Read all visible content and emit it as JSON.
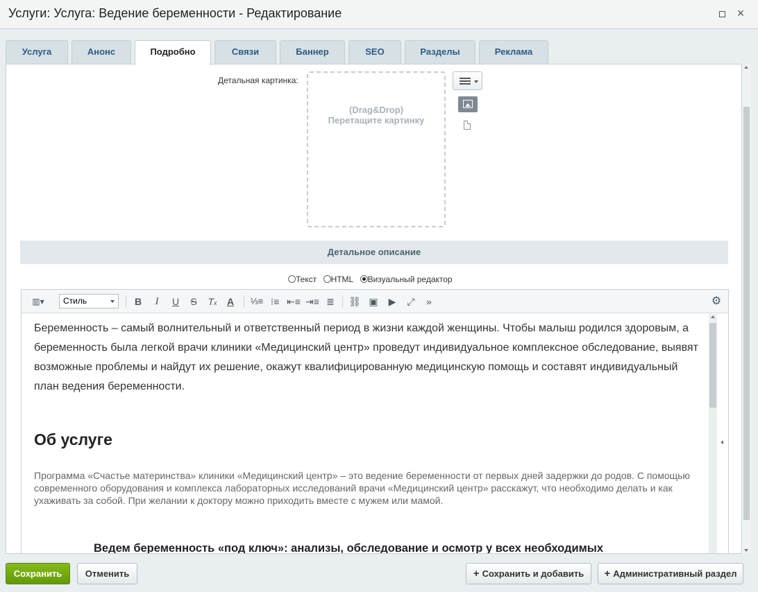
{
  "window": {
    "title": "Услуги: Услуга: Ведение беременности - Редактирование",
    "maximize_icon": "maximize-icon",
    "close_label": "×"
  },
  "tabs": [
    {
      "label": "Услуга",
      "active": false
    },
    {
      "label": "Анонс",
      "active": false
    },
    {
      "label": "Подробно",
      "active": true
    },
    {
      "label": "Связи",
      "active": false
    },
    {
      "label": "Баннер",
      "active": false
    },
    {
      "label": "SEO",
      "active": false
    },
    {
      "label": "Разделы",
      "active": false
    },
    {
      "label": "Реклама",
      "active": false
    }
  ],
  "detail_picture": {
    "label": "Детальная картинка:",
    "drop_line1": "(Drag&Drop)",
    "drop_line2": "Перетащите картинку",
    "icons": [
      "menu-icon",
      "image-icon",
      "file-icon"
    ]
  },
  "detail_description": {
    "header": "Детальное описание",
    "modes": [
      {
        "label": "Текст",
        "selected": false
      },
      {
        "label": "HTML",
        "selected": false
      },
      {
        "label": "Визуальный редактор",
        "selected": true
      }
    ]
  },
  "editor": {
    "style_select": "Стиль",
    "toolbar_icons": [
      "view-mode-icon",
      "bold-icon",
      "italic-icon",
      "underline-icon",
      "strikethrough-icon",
      "remove-format-icon",
      "font-color-icon",
      "ordered-list-icon",
      "unordered-list-icon",
      "outdent-icon",
      "indent-icon",
      "justify-icon",
      "link-icon",
      "image-icon",
      "video-icon",
      "fullscreen-icon",
      "more-icon",
      "settings-icon"
    ],
    "content": {
      "intro": "Беременность – самый волнительный и ответственный период в жизни каждой женщины. Чтобы малыш родился здоровым, а беременность была легкой врачи клиники «Медицинский центр» проведут индивидуальное комплексное обследование, выявят возможные проблемы и найдут их решение, окажут квалифицированную медицинскую помощь и составят индивидуальный план ведения беременности.",
      "heading": "Об услуге",
      "program": "Программа «Счастье материнства» клиники «Медицинский центр» – это ведение беременности от первых дней задержки до родов. С помощью современного оборудования и комплекса лабораторных исследований врачи «Медицинский центр» расскажут, что необходимо делать и как ухаживать за собой. При желании к доктору можно приходить вместе с мужем или мамой.",
      "subheading": "Ведем беременность «под ключ»: анализы, обследование и осмотр у всех необходимых"
    }
  },
  "footer": {
    "save": "Сохранить",
    "cancel": "Отменить",
    "save_and_add": "Сохранить и добавить",
    "admin_section": "Административный раздел"
  },
  "colors": {
    "save_button": "#6da512",
    "tab_text": "#2b5c87",
    "background": "#e9eef0"
  }
}
